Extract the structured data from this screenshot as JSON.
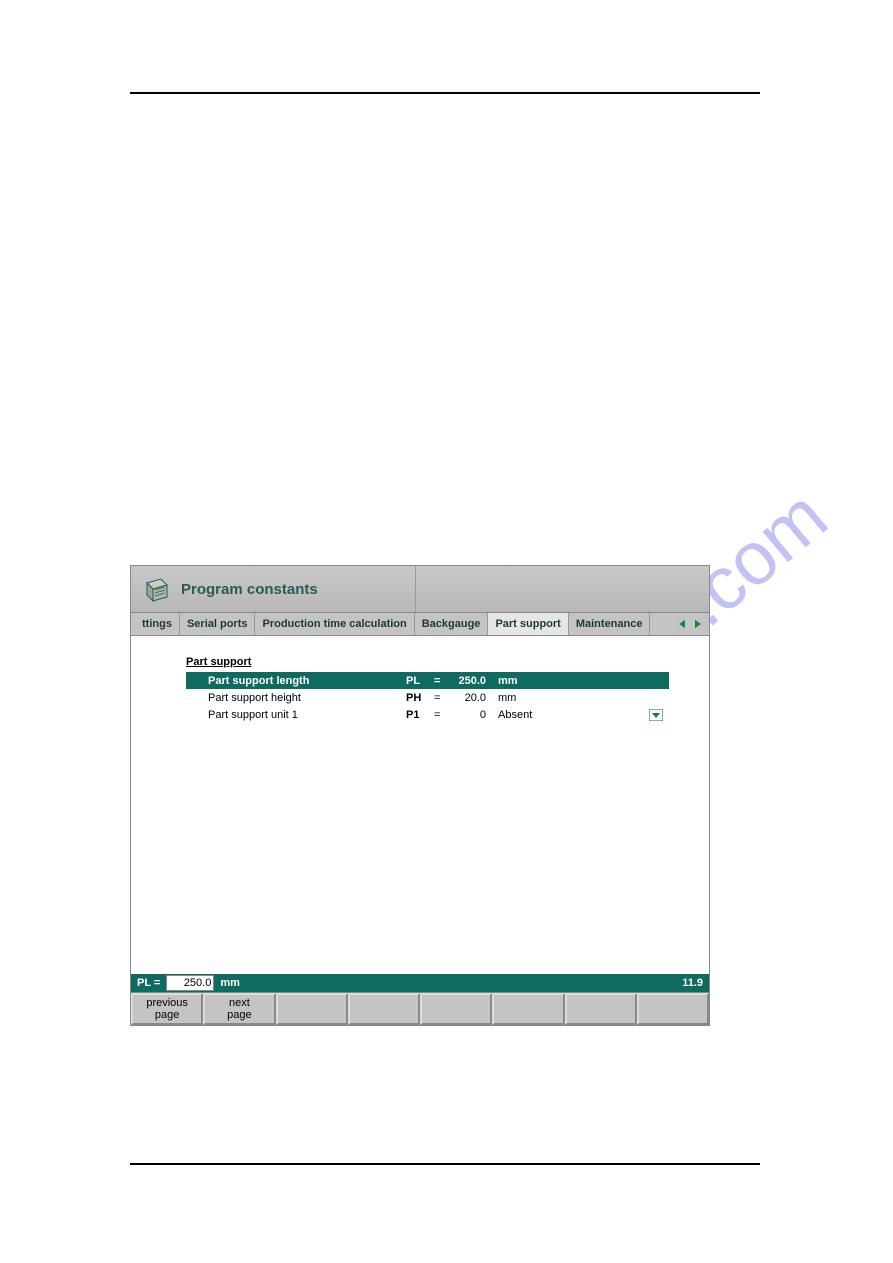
{
  "watermark": "manualshive.com",
  "window": {
    "title": "Program constants"
  },
  "tabs": {
    "items": [
      {
        "label": "ttings"
      },
      {
        "label": "Serial ports"
      },
      {
        "label": "Production time calculation"
      },
      {
        "label": "Backgauge"
      },
      {
        "label": "Part support"
      },
      {
        "label": "Maintenance"
      }
    ],
    "activeIndex": 4
  },
  "section": {
    "title": "Part support"
  },
  "rows": [
    {
      "label": "Part support length",
      "code": "PL",
      "eq": "=",
      "value": "250.0",
      "unit": "mm",
      "selected": true,
      "dropdown": false
    },
    {
      "label": "Part support height",
      "code": "PH",
      "eq": "=",
      "value": "20.0",
      "unit": "mm",
      "selected": false,
      "dropdown": false
    },
    {
      "label": "Part support unit 1",
      "code": "P1",
      "eq": "=",
      "value": "0",
      "unit": "Absent",
      "selected": false,
      "dropdown": true
    }
  ],
  "status": {
    "code": "PL =",
    "value": "250.0",
    "unit": "mm",
    "right": "11.9"
  },
  "buttons": {
    "prev": "previous\npage",
    "next": "next\npage"
  }
}
